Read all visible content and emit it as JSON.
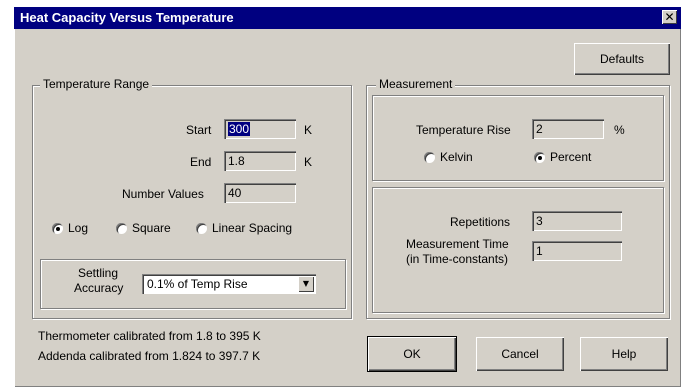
{
  "window": {
    "title": "Heat Capacity Versus Temperature",
    "close_glyph": "✕"
  },
  "buttons": {
    "defaults": "Defaults",
    "ok": "OK",
    "cancel": "Cancel",
    "help": "Help"
  },
  "temperature_range": {
    "legend": "Temperature Range",
    "start_label": "Start",
    "start_value": "300",
    "start_unit": "K",
    "end_label": "End",
    "end_value": "1.8",
    "end_unit": "K",
    "number_values_label": "Number Values",
    "number_values_value": "40",
    "spacing_options": [
      {
        "label": "Log",
        "selected": true
      },
      {
        "label": "Square",
        "selected": false
      },
      {
        "label": "Linear Spacing",
        "selected": false
      }
    ]
  },
  "settling": {
    "label_line1": "Settling",
    "label_line2": "Accuracy",
    "selected": "0.1% of Temp Rise"
  },
  "measurement": {
    "legend": "Measurement",
    "temperature_rise_label": "Temperature Rise",
    "temperature_rise_value": "2",
    "unit": "%",
    "kelvin_label": "Kelvin",
    "kelvin_selected": false,
    "percent_label": "Percent",
    "percent_selected": true
  },
  "repetitions": {
    "repetitions_label": "Repetitions",
    "repetitions_value": "3",
    "time_label_line1": "Measurement Time",
    "time_label_line2": "(in Time-constants)",
    "time_value": "1"
  },
  "calibration": {
    "line1": "Thermometer calibrated from 1.8 to 395 K",
    "line2": "Addenda calibrated from 1.824 to 397.7 K"
  }
}
